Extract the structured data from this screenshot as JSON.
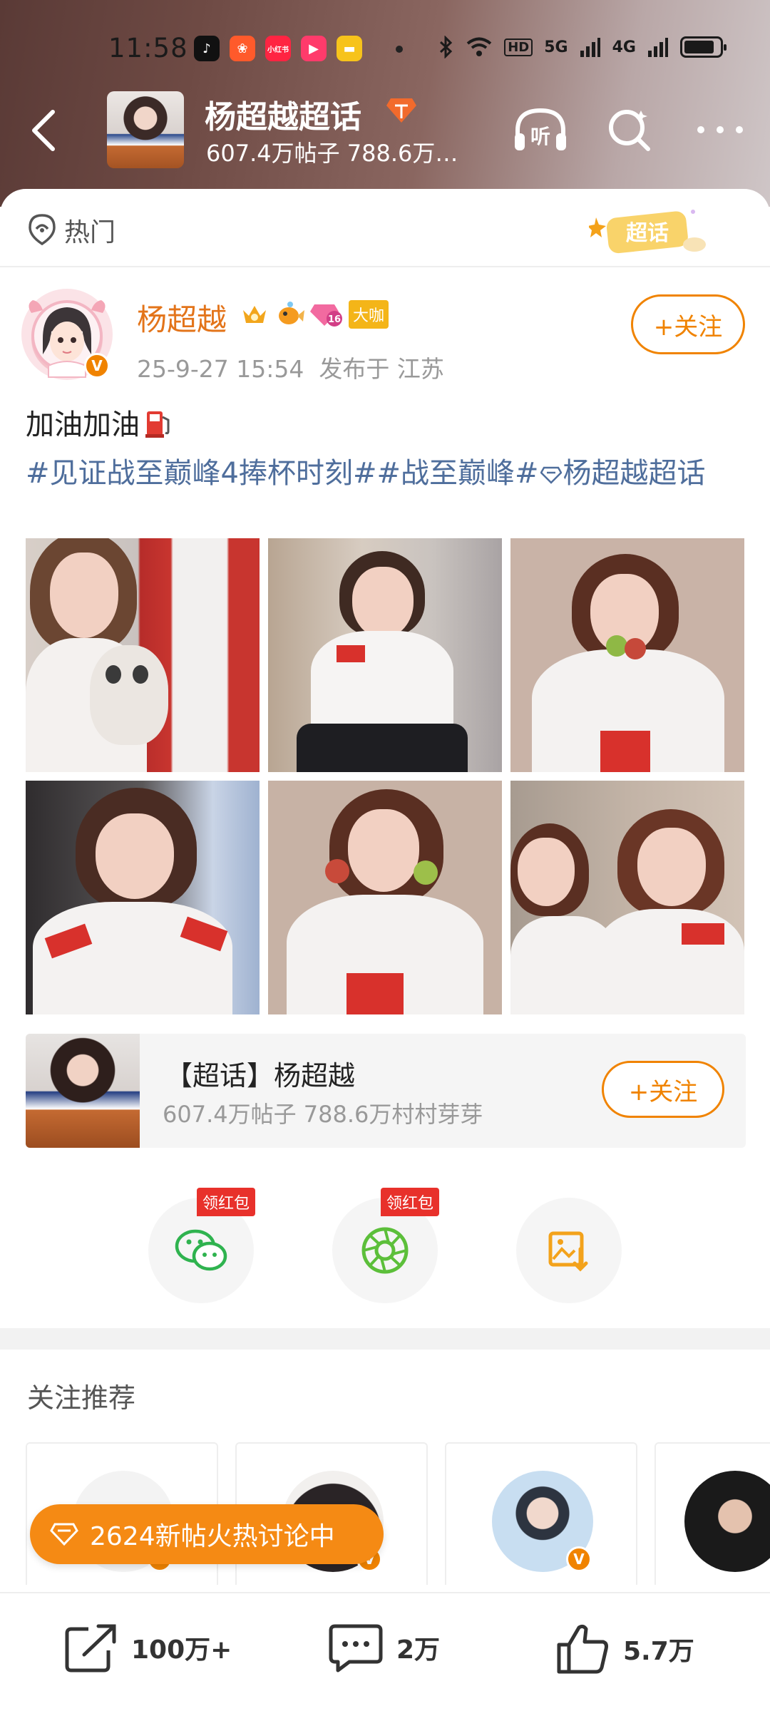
{
  "status_bar": {
    "time": "11:58",
    "app_icons": [
      {
        "name": "douyin-icon",
        "color": "#111111",
        "glyph": "♪"
      },
      {
        "name": "kuaishou-icon",
        "color": "#ff5a2b",
        "glyph": "❀"
      },
      {
        "name": "xiaohongshu-icon",
        "color": "#ff2442",
        "glyph": "小红书"
      },
      {
        "name": "video-icon",
        "color": "#ff3b6b",
        "glyph": "▶"
      },
      {
        "name": "notes-icon",
        "color": "#f7c31b",
        "glyph": "■"
      }
    ],
    "hd_label": "HD",
    "net1": "5G",
    "net2": "4G",
    "battery_level": 0.85
  },
  "nav": {
    "title": "杨超越超话",
    "subtitle": "607.4万帖子 788.6万村村芽芽",
    "listen_label": "听"
  },
  "topic_bar": {
    "tab_label": "热门",
    "sticker_text": "超话"
  },
  "post": {
    "author": "杨超越",
    "level_badge": "16",
    "big_badge": "大咖",
    "meta": "25-9-27 15:54  发布于 江苏",
    "follow_label": "+关注",
    "text": "加油加油",
    "tags": "#见证战至巅峰4捧杯时刻##战至巅峰#",
    "tag_topic": "杨超越超话"
  },
  "topic_card": {
    "name": "【超话】杨超越",
    "sub": "607.4万帖子 788.6万村村芽芽",
    "follow_label": "+关注"
  },
  "share": {
    "red_tag": "领红包"
  },
  "recommend": {
    "title": "关注推荐"
  },
  "hot_pill": {
    "text": "2624新帖火热讨论中"
  },
  "bottom_bar": {
    "share_count": "100万+",
    "comment_count": "2万",
    "like_count": "5.7万"
  }
}
